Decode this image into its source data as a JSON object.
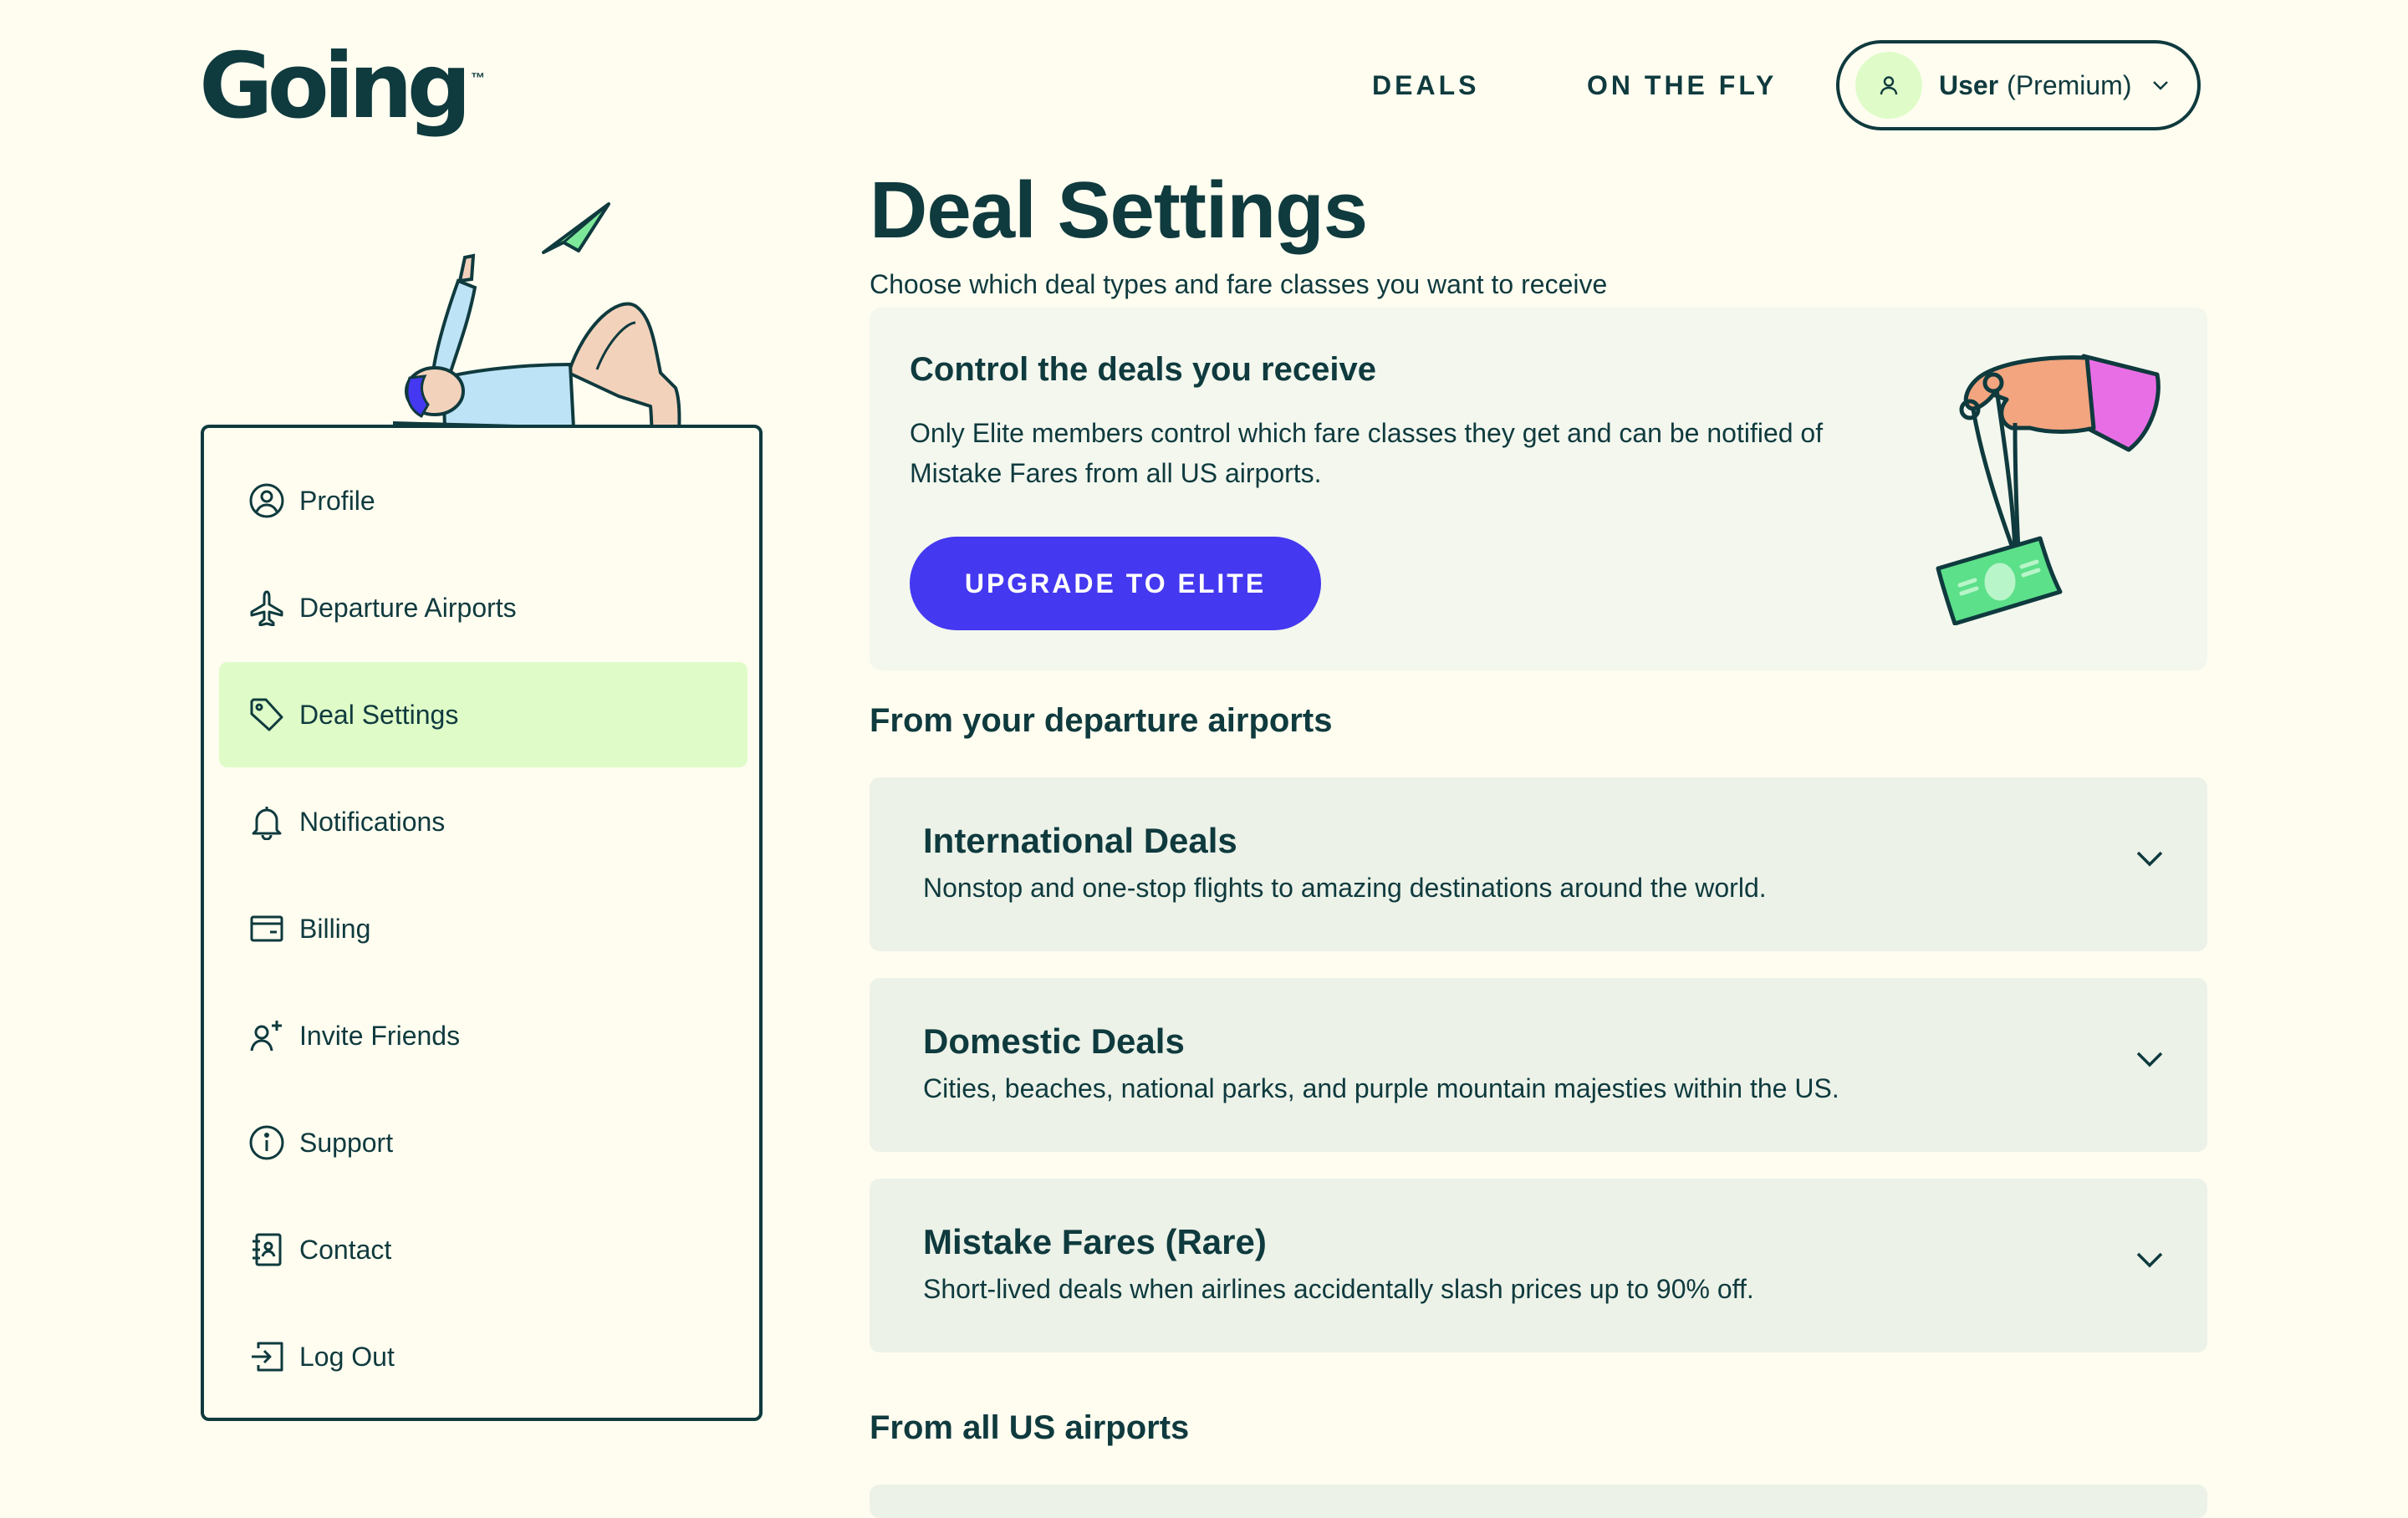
{
  "header": {
    "logo_text": "Going",
    "logo_tm": "™",
    "nav": [
      "DEALS",
      "ON THE FLY"
    ],
    "user": {
      "name": "User",
      "tier": "(Premium)"
    }
  },
  "sidebar": {
    "items": [
      {
        "label": "Profile",
        "icon": "profile-icon"
      },
      {
        "label": "Departure Airports",
        "icon": "airplane-icon"
      },
      {
        "label": "Deal Settings",
        "icon": "tag-icon",
        "active": true
      },
      {
        "label": "Notifications",
        "icon": "bell-icon"
      },
      {
        "label": "Billing",
        "icon": "wallet-icon"
      },
      {
        "label": "Invite Friends",
        "icon": "add-person-icon"
      },
      {
        "label": "Support",
        "icon": "info-icon"
      },
      {
        "label": "Contact",
        "icon": "contact-book-icon"
      },
      {
        "label": "Log Out",
        "icon": "logout-icon"
      }
    ]
  },
  "main": {
    "title": "Deal Settings",
    "subtitle": "Choose which deal types and fare classes you want to receive",
    "promo": {
      "title": "Control the deals you receive",
      "text": "Only Elite members control which fare classes they get and can be notified of Mistake Fares from all US airports.",
      "button": "UPGRADE TO ELITE"
    },
    "section1": "From your departure airports",
    "accordions": [
      {
        "title": "International Deals",
        "desc": "Nonstop and one-stop flights to amazing destinations around the world."
      },
      {
        "title": "Domestic Deals",
        "desc": "Cities, beaches, national parks, and purple mountain majesties within the US."
      },
      {
        "title": "Mistake Fares (Rare)",
        "desc": "Short-lived deals when airlines accidentally slash prices up to 90% off."
      }
    ],
    "section2": "From all US airports"
  },
  "colors": {
    "background": "#fffdf0",
    "ink": "#0f3a3e",
    "accent": "#4438f0",
    "active_item": "#dffcc8",
    "card": "#ecf2e8",
    "promo_card": "#f3f7ee"
  }
}
